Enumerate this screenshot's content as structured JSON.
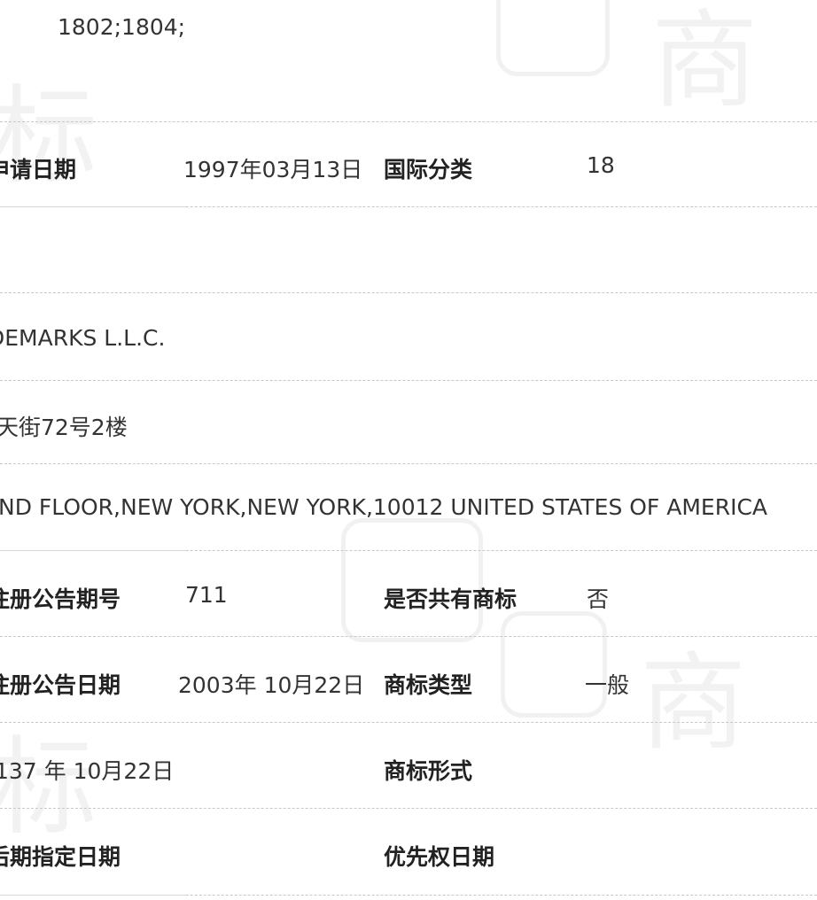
{
  "row0": {
    "value": "1802;1804;"
  },
  "row1": {
    "label1": "申请日期",
    "value1": "1997年03月13日",
    "label2": "国际分类",
    "value2": "18"
  },
  "row2": {
    "value": ""
  },
  "row3": {
    "value": "DEMARKS L.L.C."
  },
  "row4": {
    "value": "天街72号2楼"
  },
  "row5": {
    "value": "ND FLOOR,NEW YORK,NEW YORK,10012 UNITED STATES OF AMERICA"
  },
  "row6": {
    "label1": "注册公告期号",
    "value1": "711",
    "label2": "是否共有商标",
    "value2": "否"
  },
  "row7": {
    "label1": "注册公告日期",
    "value1": "2003年 10月22日",
    "label2": "商标类型",
    "value2": "一般"
  },
  "row8": {
    "value1": "137 年 10月22日",
    "label2": "商标形式",
    "value2": ""
  },
  "row9": {
    "label1": "后期指定日期",
    "label2": "优先权日期",
    "value2": ""
  },
  "watermark": {
    "glyph1": "商",
    "glyph2": "标"
  }
}
